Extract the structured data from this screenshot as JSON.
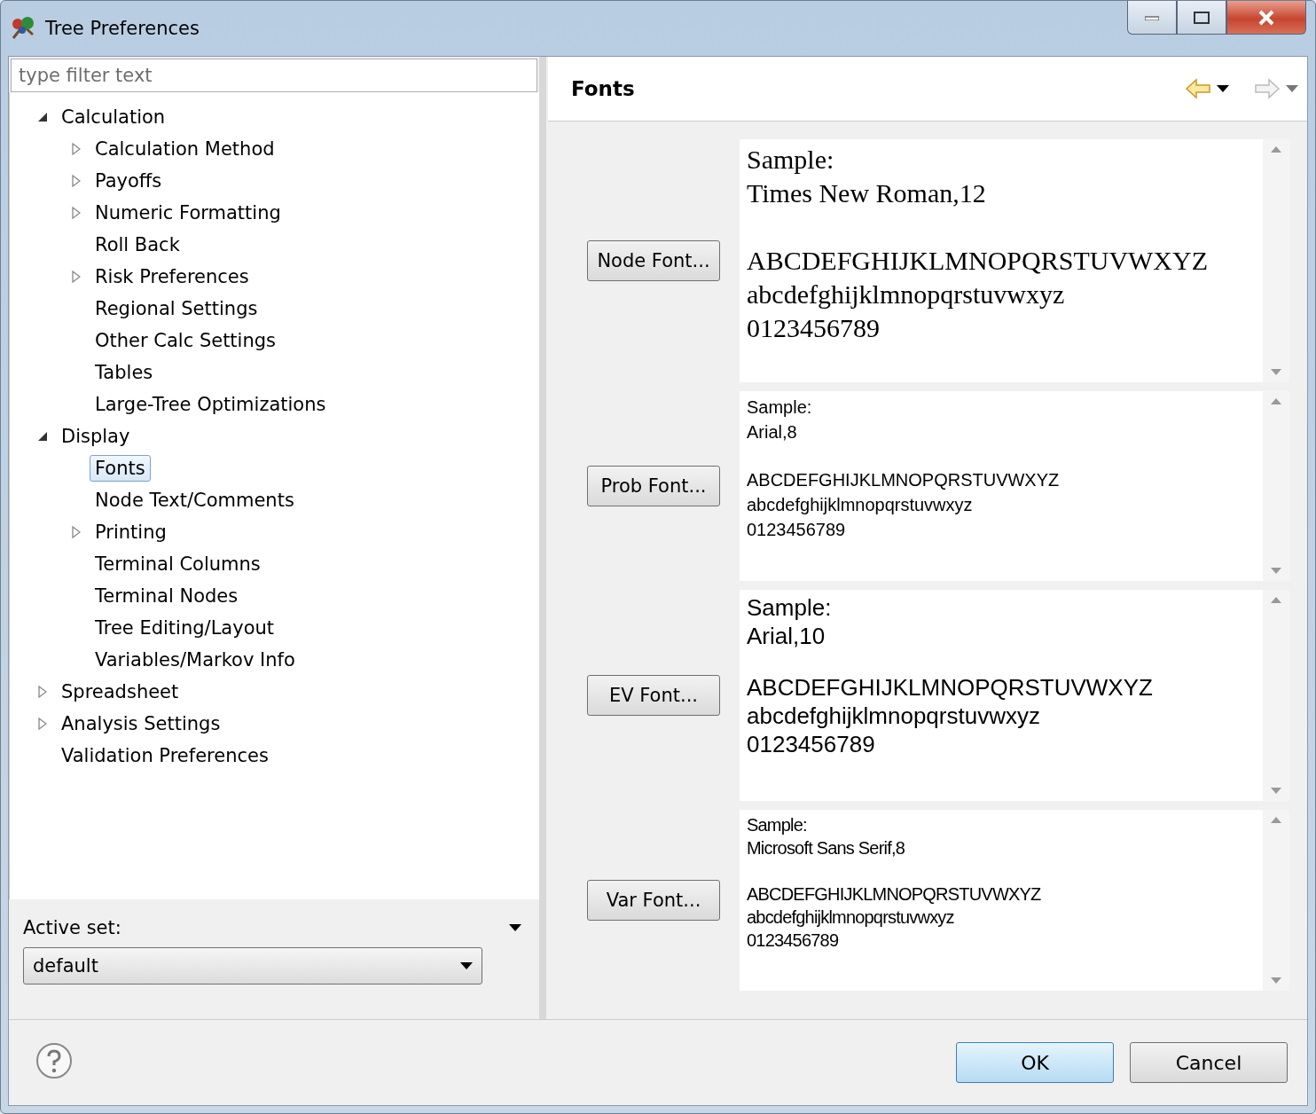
{
  "window": {
    "title": "Tree Preferences"
  },
  "filter": {
    "placeholder": "type filter text"
  },
  "tree": [
    {
      "label": "Calculation",
      "kind": "folder",
      "expanded": true,
      "selected": false,
      "children": [
        {
          "label": "Calculation Method",
          "kind": "folder",
          "expanded": false,
          "selected": false
        },
        {
          "label": "Payoffs",
          "kind": "folder",
          "expanded": false,
          "selected": false
        },
        {
          "label": "Numeric Formatting",
          "kind": "folder",
          "expanded": false,
          "selected": false
        },
        {
          "label": "Roll Back",
          "kind": "leaf",
          "selected": false
        },
        {
          "label": "Risk Preferences",
          "kind": "folder",
          "expanded": false,
          "selected": false
        },
        {
          "label": "Regional Settings",
          "kind": "leaf",
          "selected": false
        },
        {
          "label": "Other Calc Settings",
          "kind": "leaf",
          "selected": false
        },
        {
          "label": "Tables",
          "kind": "leaf",
          "selected": false
        },
        {
          "label": "Large-Tree Optimizations",
          "kind": "leaf",
          "selected": false
        }
      ]
    },
    {
      "label": "Display",
      "kind": "folder",
      "expanded": true,
      "selected": false,
      "children": [
        {
          "label": "Fonts",
          "kind": "leaf",
          "selected": true
        },
        {
          "label": "Node Text/Comments",
          "kind": "leaf",
          "selected": false
        },
        {
          "label": "Printing",
          "kind": "folder",
          "expanded": false,
          "selected": false
        },
        {
          "label": "Terminal Columns",
          "kind": "leaf",
          "selected": false
        },
        {
          "label": "Terminal Nodes",
          "kind": "leaf",
          "selected": false
        },
        {
          "label": "Tree Editing/Layout",
          "kind": "leaf",
          "selected": false
        },
        {
          "label": "Variables/Markov Info",
          "kind": "leaf",
          "selected": false
        }
      ]
    },
    {
      "label": "Spreadsheet",
      "kind": "folder",
      "expanded": false,
      "selected": false
    },
    {
      "label": "Analysis Settings",
      "kind": "folder",
      "expanded": false,
      "selected": false
    },
    {
      "label": "Validation Preferences",
      "kind": "leaf",
      "selected": false
    }
  ],
  "active_set": {
    "label": "Active set:",
    "value": "default"
  },
  "page": {
    "title": "Fonts"
  },
  "fonts": [
    {
      "button": "Node Font...",
      "kind": "serif-large",
      "sample_label": "Sample:",
      "font_name": "Times New Roman,12",
      "upper": "ABCDEFGHIJKLMNOPQRSTUVWXYZ",
      "lower": "abcdefghijklmnopqrstuvwxyz",
      "digits": "0123456789"
    },
    {
      "button": "Prob Font...",
      "kind": "sans-small",
      "sample_label": "Sample:",
      "font_name": "Arial,8",
      "upper": "ABCDEFGHIJKLMNOPQRSTUVWXYZ",
      "lower": "abcdefghijklmnopqrstuvwxyz",
      "digits": "0123456789"
    },
    {
      "button": "EV Font...",
      "kind": "sans-large",
      "sample_label": "Sample:",
      "font_name": "Arial,10",
      "upper": "ABCDEFGHIJKLMNOPQRSTUVWXYZ",
      "lower": "abcdefghijklmnopqrstuvwxyz",
      "digits": "0123456789"
    },
    {
      "button": "Var Font...",
      "kind": "sans-narrow",
      "sample_label": "Sample:",
      "font_name": "Microsoft Sans Serif,8",
      "upper": "ABCDEFGHIJKLMNOPQRSTUVWXYZ",
      "lower": "abcdefghijklmnopqrstuvwxyz",
      "digits": "0123456789"
    }
  ],
  "buttons": [
    {
      "label": "OK",
      "default": true
    },
    {
      "label": "Cancel",
      "default": false
    }
  ]
}
